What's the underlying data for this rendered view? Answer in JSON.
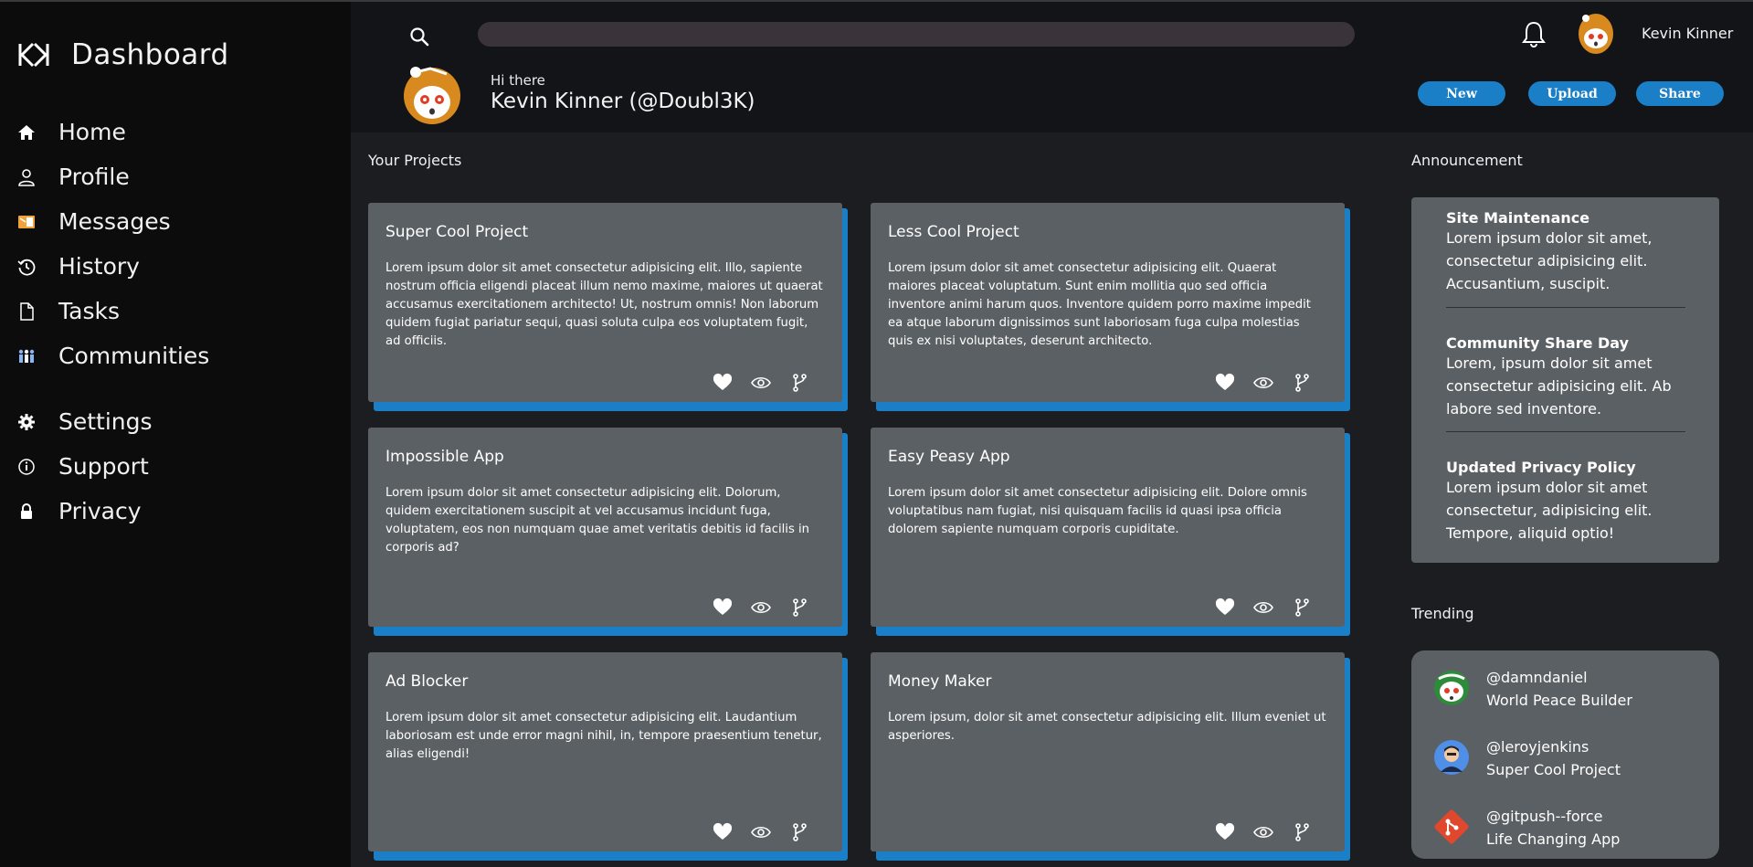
{
  "sidebar": {
    "brand": "Dashboard",
    "logo_icon": "kk-logo-icon",
    "items": [
      {
        "label": "Home",
        "icon": "home-icon"
      },
      {
        "label": "Profile",
        "icon": "user-icon"
      },
      {
        "label": "Messages",
        "icon": "messages-icon"
      },
      {
        "label": "History",
        "icon": "history-icon"
      },
      {
        "label": "Tasks",
        "icon": "document-icon"
      },
      {
        "label": "Communities",
        "icon": "people-icon"
      },
      {
        "label": "Settings",
        "icon": "gear-icon"
      },
      {
        "label": "Support",
        "icon": "info-icon"
      },
      {
        "label": "Privacy",
        "icon": "lock-icon"
      }
    ]
  },
  "header": {
    "search_placeholder": "",
    "username": "Kevin Kinner",
    "greeting": "Hi there",
    "full_name": "Kevin Kinner (@Doubl3K)",
    "buttons": {
      "new": "New",
      "upload": "Upload",
      "share": "Share"
    }
  },
  "projects": {
    "title": "Your Projects",
    "items": [
      {
        "title": "Super Cool Project",
        "description": "Lorem ipsum dolor sit amet consectetur adipisicing elit. Illo, sapiente nostrum officia eligendi placeat illum nemo maxime, maiores ut quaerat accusamus exercitationem architecto! Ut, nostrum omnis! Non laborum quidem fugiat pariatur sequi, quasi soluta culpa eos voluptatem fugit, ad officiis."
      },
      {
        "title": "Less Cool Project",
        "description": "Lorem ipsum dolor sit amet consectetur adipisicing elit. Quaerat maiores placeat voluptatum. Sunt enim mollitia quo sed officia inventore animi harum quos. Inventore quidem porro maxime impedit ea atque laborum dignissimos sunt laboriosam fuga culpa molestias quis ex nisi voluptates, deserunt architecto."
      },
      {
        "title": "Impossible App",
        "description": "Lorem ipsum dolor sit amet consectetur adipisicing elit. Dolorum, quidem exercitationem suscipit at vel accusamus incidunt fuga, voluptatem, eos non numquam quae amet veritatis debitis id facilis in corporis ad?"
      },
      {
        "title": "Easy Peasy App",
        "description": "Lorem ipsum dolor sit amet consectetur adipisicing elit. Dolore omnis voluptatibus nam fugiat, nisi quisquam facilis id quasi ipsa officia dolorem sapiente numquam corporis cupiditate."
      },
      {
        "title": "Ad Blocker",
        "description": "Lorem ipsum dolor sit amet consectetur adipisicing elit. Laudantium laboriosam est unde error magni nihil, in, tempore praesentium tenetur, alias eligendi!"
      },
      {
        "title": "Money Maker",
        "description": "Lorem ipsum, dolor sit amet consectetur adipisicing elit. Illum eveniet ut asperiores."
      }
    ]
  },
  "announcement": {
    "title": "Announcement",
    "items": [
      {
        "title": "Site Maintenance",
        "text": "Lorem ipsum dolor sit amet, consectetur adipisicing elit. Accusantium, suscipit."
      },
      {
        "title": "Community Share Day",
        "text": "Lorem, ipsum dolor sit amet consectetur adipisicing elit. Ab labore sed inventore."
      },
      {
        "title": "Updated Privacy Policy",
        "text": "Lorem ipsum dolor sit amet consectetur, adipisicing elit. Tempore, aliquid optio!"
      }
    ]
  },
  "trending": {
    "title": "Trending",
    "items": [
      {
        "handle": "@damndaniel",
        "project": "World Peace Builder"
      },
      {
        "handle": "@leroyjenkins",
        "project": "Super Cool Project"
      },
      {
        "handle": "@gitpush--force",
        "project": "Life Changing App"
      }
    ]
  },
  "colors": {
    "accent": "#1b7fc8",
    "sidebar": "#0c0c0c",
    "header": "#131417",
    "background": "#1b1d21",
    "card": "#5b6064"
  }
}
